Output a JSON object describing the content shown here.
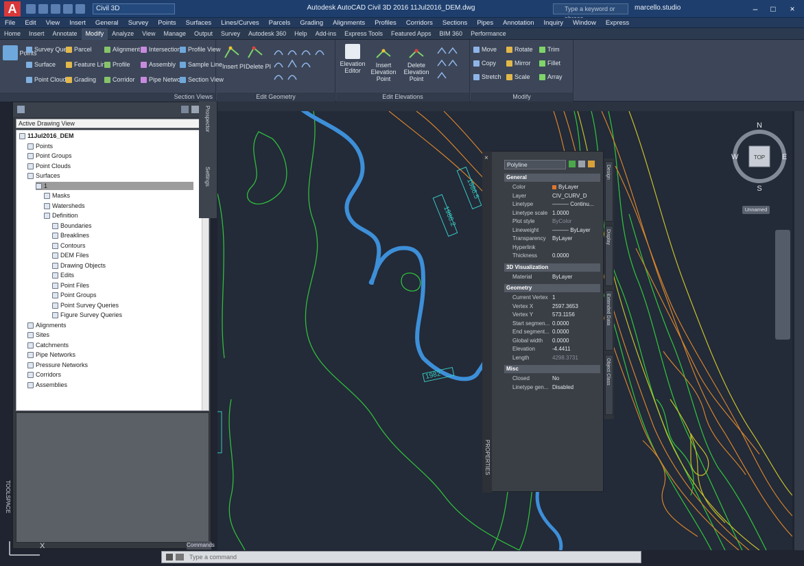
{
  "titlebar": {
    "app_letter": "A",
    "workspace": "Civil 3D",
    "doc_title": "Autodesk AutoCAD Civil 3D 2016   11Jul2016_DEM.dwg",
    "search_placeholder": "Type a keyword or phrase",
    "user": "marcello.studio"
  },
  "menubar": {
    "items": [
      "File",
      "Edit",
      "View",
      "Insert",
      "General",
      "Survey",
      "Points",
      "Surfaces",
      "Lines/Curves",
      "Parcels",
      "Grading",
      "Alignments",
      "Profiles",
      "Corridors",
      "Sections",
      "Pipes",
      "Annotation",
      "Inquiry",
      "Window",
      "Express"
    ]
  },
  "ribbon": {
    "tabs": [
      {
        "label": "Home",
        "active": false
      },
      {
        "label": "Insert",
        "active": false
      },
      {
        "label": "Annotate",
        "active": false
      },
      {
        "label": "Modify",
        "active": true
      },
      {
        "label": "Analyze",
        "active": false
      },
      {
        "label": "View",
        "active": false
      },
      {
        "label": "Manage",
        "active": false
      },
      {
        "label": "Output",
        "active": false
      },
      {
        "label": "Survey",
        "active": false
      },
      {
        "label": "Autodesk 360",
        "active": false
      },
      {
        "label": "Help",
        "active": false
      },
      {
        "label": "Add-ins",
        "active": false
      },
      {
        "label": "Express Tools",
        "active": false
      },
      {
        "label": "Featured Apps",
        "active": false
      },
      {
        "label": "BIM 360",
        "active": false
      },
      {
        "label": "Performance",
        "active": false
      }
    ],
    "ground_data": {
      "points": "Points",
      "col1": [
        "Survey Query",
        "Surface",
        "Point Cloud"
      ],
      "col2": [
        "Parcel",
        "Feature Line",
        "Grading"
      ],
      "col3": [
        "Alignment",
        "Profile",
        "Corridor"
      ],
      "col4": [
        "Intersection",
        "Assembly",
        "Pipe Network"
      ],
      "col5": [
        "Profile View",
        "Sample Line",
        "Section View"
      ]
    },
    "panel_view_title": "Section Views",
    "edit_geometry": {
      "insert_pi": "Insert PI",
      "delete_pi": "Delete PI",
      "title": "Edit Geometry"
    },
    "edit_elevations": {
      "editor": "Elevation Editor",
      "insert": "Insert Elevation Point",
      "delete": "Delete Elevation Point",
      "title": "Edit Elevations"
    },
    "modify": {
      "items": [
        "Move",
        "Rotate",
        "Trim",
        "Copy",
        "Mirror",
        "Fillet",
        "Stretch",
        "Scale",
        "Array"
      ],
      "title": "Modify"
    }
  },
  "prospector": {
    "view_select": "Active Drawing View",
    "tree": [
      {
        "label": "11Jul2016_DEM",
        "level": 0,
        "bold": true
      },
      {
        "label": "Points",
        "level": 1
      },
      {
        "label": "Point Groups",
        "level": 1
      },
      {
        "label": "Point Clouds",
        "level": 1
      },
      {
        "label": "Surfaces",
        "level": 1
      },
      {
        "label": "1",
        "level": 2,
        "selected": true
      },
      {
        "label": "Masks",
        "level": 3
      },
      {
        "label": "Watersheds",
        "level": 3
      },
      {
        "label": "Definition",
        "level": 3
      },
      {
        "label": "Boundaries",
        "level": 4
      },
      {
        "label": "Breaklines",
        "level": 4
      },
      {
        "label": "Contours",
        "level": 4
      },
      {
        "label": "DEM Files",
        "level": 4
      },
      {
        "label": "Drawing Objects",
        "level": 4
      },
      {
        "label": "Edits",
        "level": 4
      },
      {
        "label": "Point Files",
        "level": 4
      },
      {
        "label": "Point Groups",
        "level": 4
      },
      {
        "label": "Point Survey Queries",
        "level": 4
      },
      {
        "label": "Figure Survey Queries",
        "level": 4
      },
      {
        "label": "Alignments",
        "level": 1
      },
      {
        "label": "Sites",
        "level": 1
      },
      {
        "label": "Catchments",
        "level": 1
      },
      {
        "label": "Pipe Networks",
        "level": 1
      },
      {
        "label": "Pressure Networks",
        "level": 1
      },
      {
        "label": "Corridors",
        "level": 1
      },
      {
        "label": "Assemblies",
        "level": 1
      }
    ],
    "side_tab": "Settings",
    "prospector_tab": "Prospector",
    "toolspace": "TOOLSPACE"
  },
  "properties": {
    "object": "Polyline",
    "sections": {
      "general": "General",
      "viz": "3D Visualization",
      "geometry": "Geometry",
      "misc": "Misc"
    },
    "general": [
      {
        "k": "Color",
        "v": "ByLayer",
        "swatch": true
      },
      {
        "k": "Layer",
        "v": "CIV_CURV_D"
      },
      {
        "k": "Linetype",
        "v": "——— Continu..."
      },
      {
        "k": "Linetype scale",
        "v": "1.0000"
      },
      {
        "k": "Plot style",
        "v": "ByColor",
        "dim": true
      },
      {
        "k": "Lineweight",
        "v": "——— ByLayer"
      },
      {
        "k": "Transparency",
        "v": "ByLayer"
      },
      {
        "k": "Hyperlink",
        "v": ""
      },
      {
        "k": "Thickness",
        "v": "0.0000"
      }
    ],
    "viz": [
      {
        "k": "Material",
        "v": "ByLayer"
      }
    ],
    "geometry": [
      {
        "k": "Current Vertex",
        "v": "1"
      },
      {
        "k": "Vertex X",
        "v": "2597.3653"
      },
      {
        "k": "Vertex Y",
        "v": "573.1156"
      },
      {
        "k": "Start segmen...",
        "v": "0.0000"
      },
      {
        "k": "End segment...",
        "v": "0.0000"
      },
      {
        "k": "Global width",
        "v": "0.0000"
      },
      {
        "k": "Elevation",
        "v": "-4.4411"
      },
      {
        "k": "Length",
        "v": "4298.3731",
        "dim": true
      }
    ],
    "misc": [
      {
        "k": "Closed",
        "v": "No"
      },
      {
        "k": "Linetype gen...",
        "v": "Disabled"
      }
    ],
    "side_tabs": [
      "Design",
      "Display",
      "Extended Data",
      "Object Class"
    ],
    "palette_label": "PROPERTIES"
  },
  "drawing": {
    "labels": [
      "1986.5",
      "1986.2",
      "1982",
      "1986.5"
    ]
  },
  "viewcube": {
    "n": "N",
    "s": "S",
    "e": "E",
    "w": "W",
    "top": "TOP",
    "wcs": "Unnamed"
  },
  "cmd": {
    "placeholder": "Type a command"
  },
  "commands_label": "Commands",
  "colors": {
    "contour_green": "#2fbf3a",
    "contour_orange": "#d6842b",
    "contour_yellow": "#c7c12a",
    "selected_blue": "#3d8fd8",
    "label_cyan": "#38c9c0"
  }
}
